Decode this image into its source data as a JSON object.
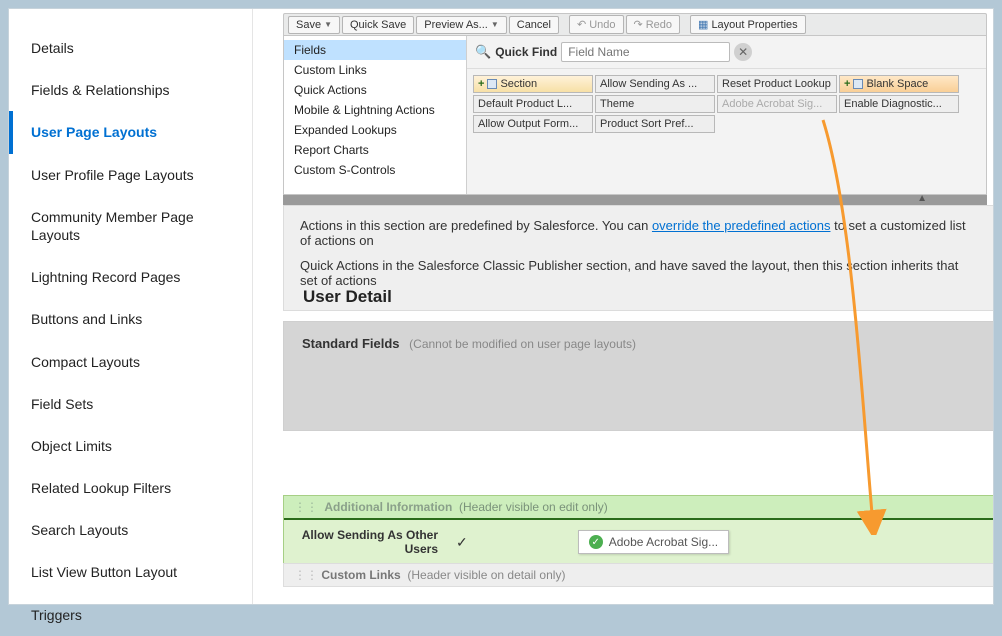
{
  "sidebar": {
    "items": [
      {
        "label": "Details"
      },
      {
        "label": "Fields & Relationships"
      },
      {
        "label": "User Page Layouts",
        "selected": true
      },
      {
        "label": "User Profile Page Layouts"
      },
      {
        "label": "Community Member Page Layouts"
      },
      {
        "label": "Lightning Record Pages"
      },
      {
        "label": "Buttons and Links"
      },
      {
        "label": "Compact Layouts"
      },
      {
        "label": "Field Sets"
      },
      {
        "label": "Object Limits"
      },
      {
        "label": "Related Lookup Filters"
      },
      {
        "label": "Search Layouts"
      },
      {
        "label": "List View Button Layout"
      },
      {
        "label": "Triggers"
      }
    ]
  },
  "toolbar": {
    "save": "Save",
    "quick_save": "Quick Save",
    "preview": "Preview As...",
    "cancel": "Cancel",
    "undo": "Undo",
    "redo": "Redo",
    "layout_props": "Layout Properties"
  },
  "palette": {
    "categories": [
      "Fields",
      "Custom Links",
      "Quick Actions",
      "Mobile & Lightning Actions",
      "Expanded Lookups",
      "Report Charts",
      "Custom S-Controls"
    ],
    "selected_category": "Fields",
    "quick_find_label": "Quick Find",
    "quick_find_placeholder": "Field Name",
    "chips": [
      {
        "label": "Section",
        "kind": "section"
      },
      {
        "label": "Allow Sending As ...",
        "kind": "field"
      },
      {
        "label": "Reset Product Lookup",
        "kind": "field"
      },
      {
        "label": "Blank Space",
        "kind": "blank"
      },
      {
        "label": "Default Product L...",
        "kind": "field"
      },
      {
        "label": "Theme",
        "kind": "field"
      },
      {
        "label": "Adobe Acrobat Sig...",
        "kind": "disabled"
      },
      {
        "label": "Enable Diagnostic...",
        "kind": "field"
      },
      {
        "label": "Allow Output Form...",
        "kind": "field"
      },
      {
        "label": "Product Sort Pref...",
        "kind": "field"
      }
    ]
  },
  "info": {
    "line1_a": "Actions in this section are predefined by Salesforce. You can ",
    "line1_link": "override the predefined actions",
    "line1_b": " to set a customized list of actions on",
    "line2": "Quick Actions in the Salesforce Classic Publisher section, and have saved the layout, then this section inherits that set of actions"
  },
  "detail": {
    "section_title": "User Detail",
    "standard_fields_title": "Standard Fields",
    "standard_fields_note": "(Cannot be modified on user page layouts)",
    "additional_info_title": "Additional Information",
    "additional_info_note": "(Header visible on edit only)",
    "allow_sending_label": "Allow Sending As Other Users",
    "allow_sending_checked": "✓",
    "dropped_field": "Adobe Acrobat Sig...",
    "custom_links_title": "Custom Links",
    "custom_links_note": "(Header visible on detail only)"
  }
}
